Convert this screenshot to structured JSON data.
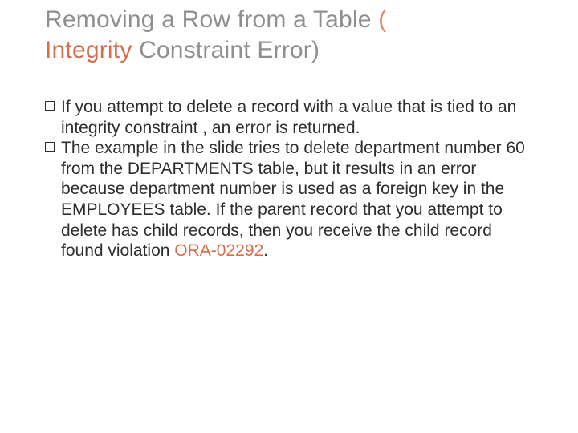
{
  "title": {
    "line1_plain": "Removing a Row from a Table ",
    "line1_accent": "(",
    "line2_accent": "Integrity ",
    "line2_plain": "Constraint Error)"
  },
  "bullets": [
    {
      "text": "If you attempt to delete a record with a value that is tied to an integrity constraint , an error is returned."
    },
    {
      "text_before": "The example in the slide tries to delete department number 60 from the DEPARTMENTS table, but it results in an error because department number is used as a foreign key in the EMPLOYEES table. If the parent record that you attempt to delete has child records, then you receive the child record found violation ",
      "ora_code": "ORA-02292",
      "text_after": "."
    }
  ]
}
